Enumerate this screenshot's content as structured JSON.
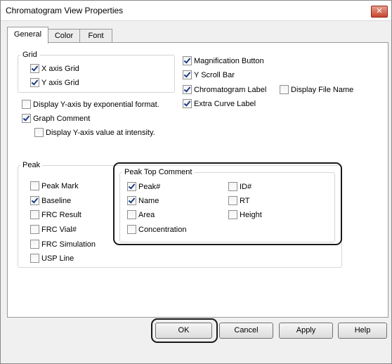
{
  "window": {
    "title": "Chromatogram View Properties",
    "close_glyph": "✕"
  },
  "tabs": [
    {
      "label": "General"
    },
    {
      "label": "Color"
    },
    {
      "label": "Font"
    }
  ],
  "grid_group": {
    "title": "Grid",
    "x_axis_grid": {
      "label": "X axis Grid",
      "checked": true
    },
    "y_axis_grid": {
      "label": "Y axis Grid",
      "checked": true
    }
  },
  "options": {
    "exp_format": {
      "label": "Display Y-axis by exponential format.",
      "checked": false
    },
    "graph_comment": {
      "label": "Graph Comment",
      "checked": true
    },
    "intensity": {
      "label": "Display Y-axis value at intensity.",
      "checked": false
    },
    "magnification": {
      "label": "Magnification Button",
      "checked": true
    },
    "y_scroll": {
      "label": "Y Scroll Bar",
      "checked": true
    },
    "chrom_label": {
      "label": "Chromatogram Label",
      "checked": true
    },
    "file_name": {
      "label": "Display File Name",
      "checked": false
    },
    "extra_curve": {
      "label": "Extra Curve Label",
      "checked": true
    }
  },
  "peak_group": {
    "title": "Peak",
    "items": [
      {
        "label": "Peak Mark",
        "checked": false
      },
      {
        "label": "Baseline",
        "checked": true
      },
      {
        "label": "FRC Result",
        "checked": false
      },
      {
        "label": "FRC Vial#",
        "checked": false
      },
      {
        "label": "FRC Simulation",
        "checked": false
      },
      {
        "label": "USP Line",
        "checked": false
      }
    ]
  },
  "peak_top": {
    "title": "Peak Top Comment",
    "items": [
      {
        "label": "Peak#",
        "checked": true
      },
      {
        "label": "Name",
        "checked": true
      },
      {
        "label": "Area",
        "checked": false
      },
      {
        "label": "Concentration",
        "checked": false
      },
      {
        "label": "ID#",
        "checked": false
      },
      {
        "label": "RT",
        "checked": false
      },
      {
        "label": "Height",
        "checked": false
      }
    ]
  },
  "buttons": {
    "ok": "OK",
    "cancel": "Cancel",
    "apply": "Apply",
    "help": "Help"
  }
}
